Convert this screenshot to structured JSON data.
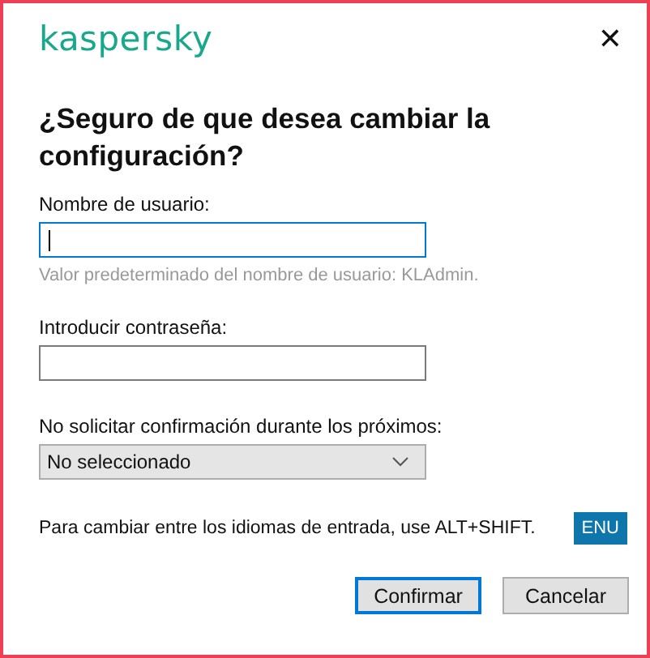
{
  "window": {
    "logo": "kaspersky",
    "close": "✕"
  },
  "title": "¿Seguro de que desea cambiar la configuración?",
  "fields": [
    {
      "kind": "text",
      "label": "Nombre de usuario:",
      "focused": true,
      "hint": "Valor predeterminado del nombre de usuario: KLAdmin."
    },
    {
      "kind": "text",
      "label": "Introducir contraseña:",
      "focused": false
    },
    {
      "kind": "select",
      "label": "No solicitar confirmación durante los próximos:",
      "value": "No seleccionado"
    }
  ],
  "language_note": "Para cambiar entre los idiomas de entrada, use ALT+SHIFT.",
  "language_badge": "ENU",
  "buttons": [
    {
      "label": "Confirmar",
      "default": true
    },
    {
      "label": "Cancelar",
      "default": false
    }
  ]
}
